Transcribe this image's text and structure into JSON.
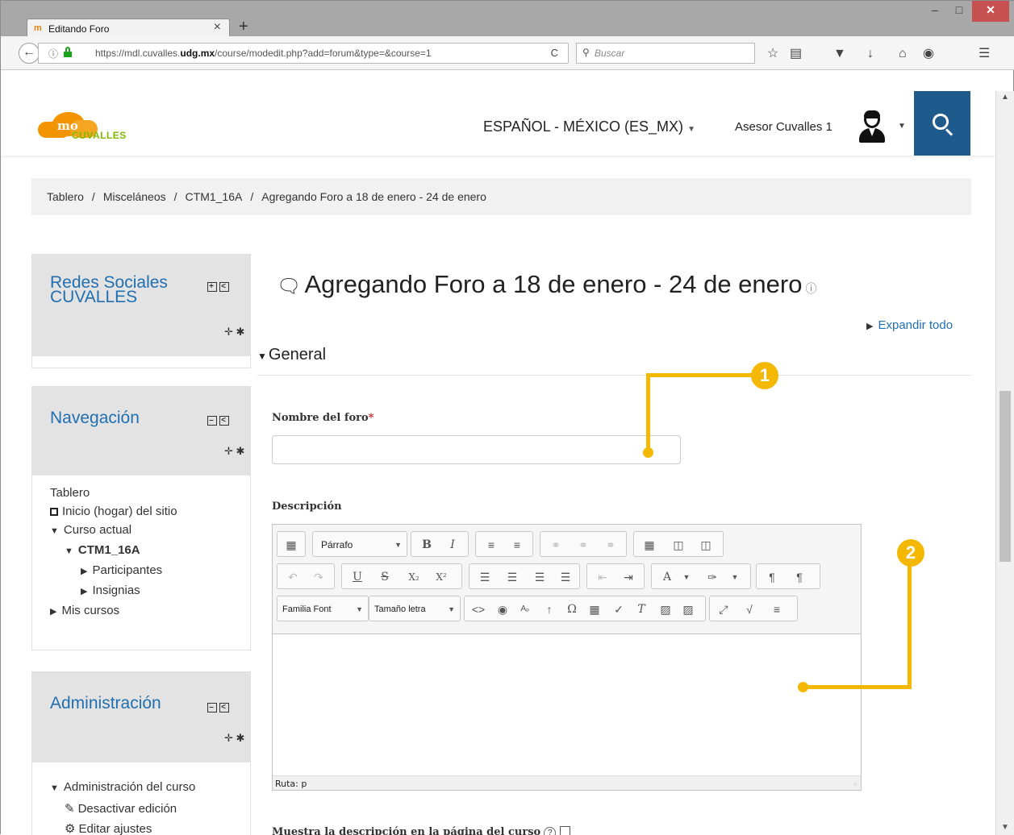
{
  "browser": {
    "tab_title": "Editando Foro",
    "tab_favicon": "m",
    "url_prefix": "https://mdl.cuvalles.",
    "url_domain": "udg.mx",
    "url_suffix": "/course/modedit.php?add=forum&type=&course=1",
    "search_placeholder": "Buscar",
    "info_icon": "ⓘ",
    "reload_icon": "C",
    "new_tab": "+",
    "close_tab": "×"
  },
  "header": {
    "logo_text": "CUVALLES",
    "logo_mark": "mo",
    "language": "ESPAÑOL - MÉXICO (ES_MX)",
    "user_name": "Asesor Cuvalles 1"
  },
  "breadcrumb": {
    "items": [
      "Tablero",
      "Misceláneos",
      "CTM1_16A",
      "Agregando Foro a 18 de enero - 24 de enero"
    ]
  },
  "blocks": {
    "social": {
      "title_line1": "Redes Sociales",
      "title_line2": "CUVALLES"
    },
    "navigation": {
      "title": "Navegación",
      "items": [
        "Tablero",
        "Inicio (hogar) del sitio",
        "Curso actual",
        "CTM1_16A",
        "Participantes",
        "Insignias",
        "Mis cursos"
      ]
    },
    "admin": {
      "title": "Administración",
      "items": [
        "Administración del curso",
        "Desactivar edición",
        "Editar ajustes"
      ]
    }
  },
  "main": {
    "title": "Agregando Foro a 18 de enero - 24 de enero",
    "expand_all": "Expandir todo",
    "section": "General",
    "name_label": "Nombre del foro",
    "required_mark": "*",
    "description_label": "Descripción",
    "show_description_label": "Muestra la descripción en la página del curso",
    "help_mark": "?"
  },
  "editor": {
    "format_select": "Párrafo",
    "font_family": "Familia Font",
    "font_size": "Tamaño letra",
    "status_path": "Ruta: p"
  },
  "callouts": [
    "1",
    "2"
  ],
  "colors": {
    "link_blue": "#1f6fb2",
    "header_search_bg": "#1e5a8c",
    "callout": "#f5b800",
    "logo_orange": "#f29400",
    "logo_green": "#7fba00"
  }
}
